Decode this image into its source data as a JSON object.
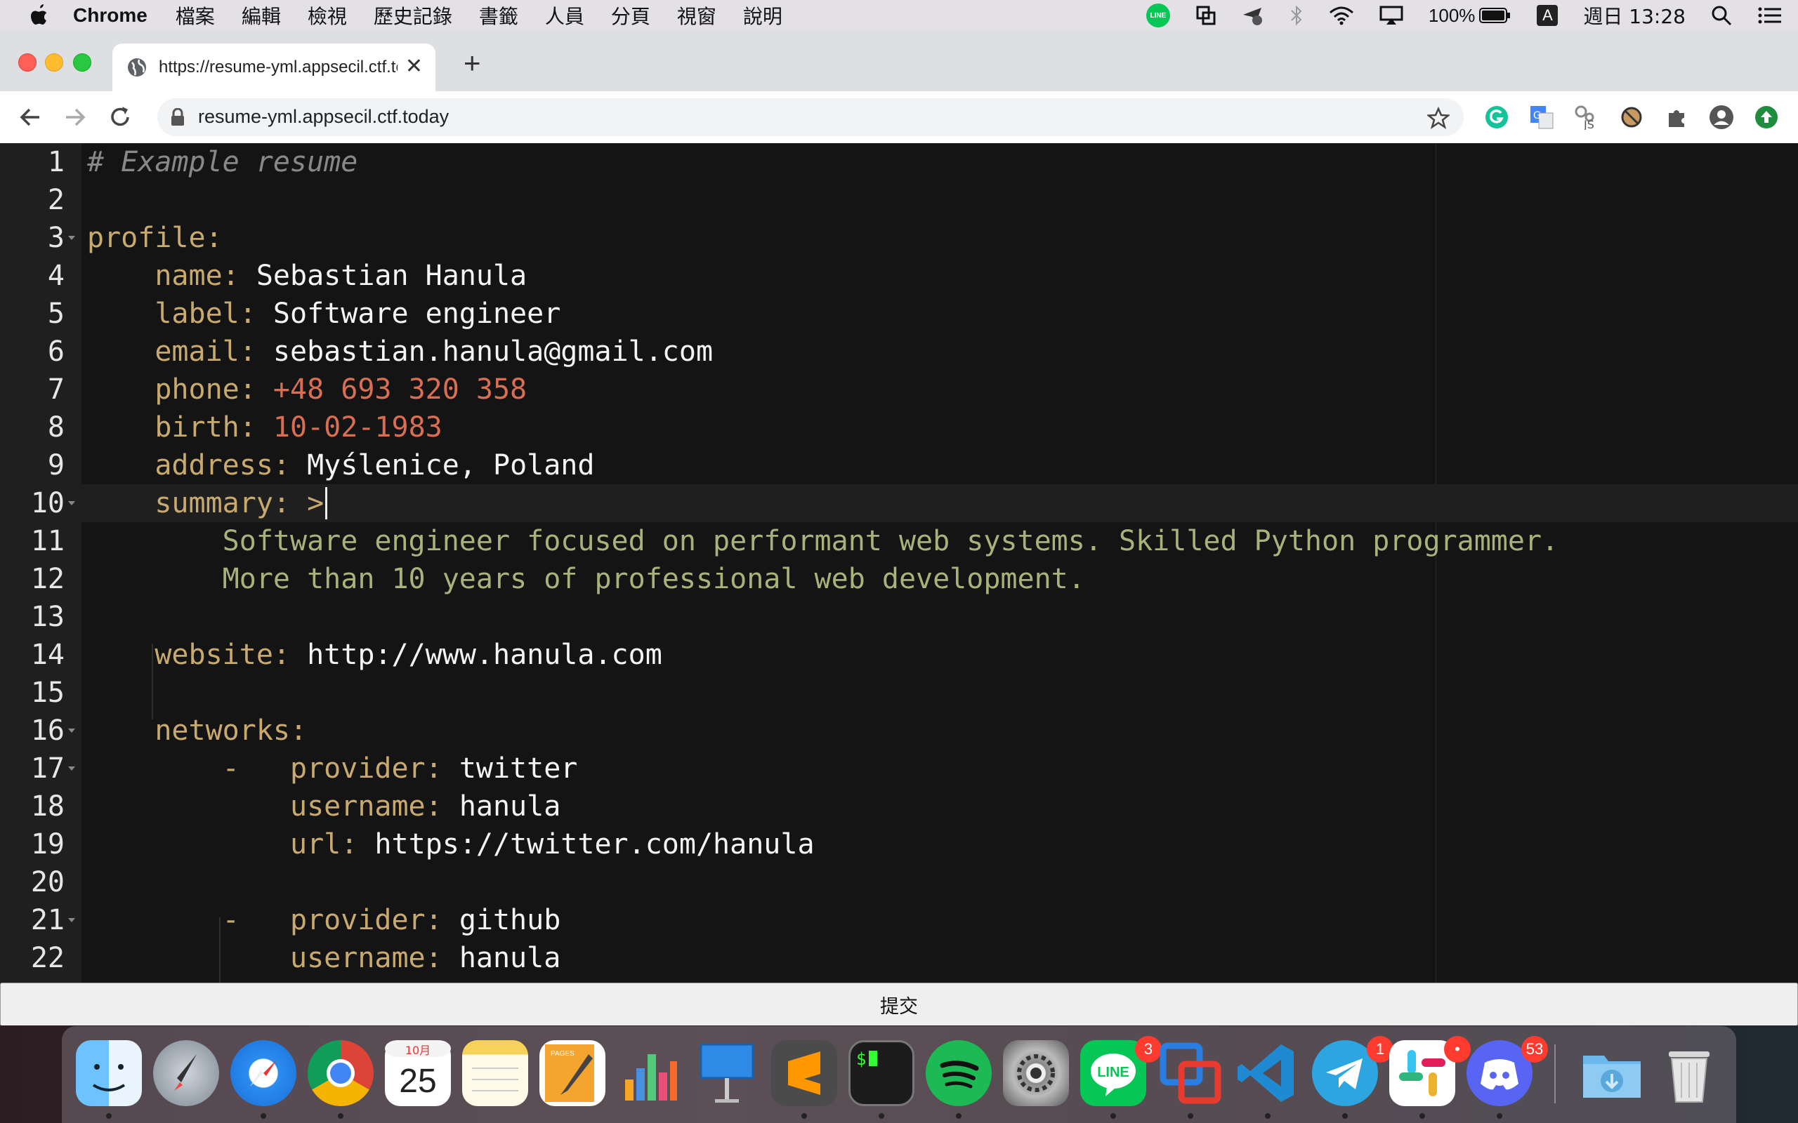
{
  "menubar": {
    "app_name": "Chrome",
    "items": [
      "檔案",
      "編輯",
      "檢視",
      "歷史記錄",
      "書籤",
      "人員",
      "分頁",
      "視窗",
      "說明"
    ],
    "line_label": "LINE",
    "battery": "100%",
    "input_method": "A",
    "clock": "週日 13:28"
  },
  "browser": {
    "tab_title": "https://resume-yml.appsecil.ctf.today",
    "url": "resume-yml.appsecil.ctf.today"
  },
  "editor": {
    "lines": [
      {
        "n": "1",
        "tokens": [
          {
            "t": "# Example resume",
            "c": "cmt"
          }
        ]
      },
      {
        "n": "2",
        "tokens": []
      },
      {
        "n": "3",
        "fold": true,
        "tokens": [
          {
            "t": "profile:",
            "c": "k"
          }
        ]
      },
      {
        "n": "4",
        "tokens": [
          {
            "t": "    name: ",
            "c": "k"
          },
          {
            "t": "Sebastian Hanula",
            "c": "v"
          }
        ]
      },
      {
        "n": "5",
        "tokens": [
          {
            "t": "    label: ",
            "c": "k"
          },
          {
            "t": "Software engineer",
            "c": "v"
          }
        ]
      },
      {
        "n": "6",
        "tokens": [
          {
            "t": "    email: ",
            "c": "k"
          },
          {
            "t": "sebastian.hanula@gmail.com",
            "c": "v"
          }
        ]
      },
      {
        "n": "7",
        "tokens": [
          {
            "t": "    phone: ",
            "c": "k"
          },
          {
            "t": "+48 693 320 358",
            "c": "num"
          }
        ]
      },
      {
        "n": "8",
        "tokens": [
          {
            "t": "    birth: ",
            "c": "k"
          },
          {
            "t": "10-02-1983",
            "c": "num"
          }
        ]
      },
      {
        "n": "9",
        "tokens": [
          {
            "t": "    address: ",
            "c": "k"
          },
          {
            "t": "Myślenice, Poland",
            "c": "v"
          }
        ]
      },
      {
        "n": "10",
        "fold": true,
        "active": true,
        "tokens": [
          {
            "t": "    summary: >",
            "c": "k"
          }
        ]
      },
      {
        "n": "11",
        "tokens": [
          {
            "t": "        Software engineer focused on performant web systems. Skilled Python programmer.",
            "c": "str"
          }
        ]
      },
      {
        "n": "12",
        "tokens": [
          {
            "t": "        More than 10 years of professional web development.",
            "c": "str"
          }
        ]
      },
      {
        "n": "13",
        "tokens": []
      },
      {
        "n": "14",
        "tokens": [
          {
            "t": "    website: ",
            "c": "k"
          },
          {
            "t": "http://www.hanula.com",
            "c": "v"
          }
        ]
      },
      {
        "n": "15",
        "tokens": []
      },
      {
        "n": "16",
        "fold": true,
        "tokens": [
          {
            "t": "    networks:",
            "c": "k"
          }
        ]
      },
      {
        "n": "17",
        "fold": true,
        "tokens": [
          {
            "t": "        -   ",
            "c": "k"
          },
          {
            "t": "provider: ",
            "c": "k"
          },
          {
            "t": "twitter",
            "c": "v"
          }
        ]
      },
      {
        "n": "18",
        "tokens": [
          {
            "t": "            username: ",
            "c": "k"
          },
          {
            "t": "hanula",
            "c": "v"
          }
        ]
      },
      {
        "n": "19",
        "tokens": [
          {
            "t": "            url: ",
            "c": "k"
          },
          {
            "t": "https://twitter.com/hanula",
            "c": "v"
          }
        ]
      },
      {
        "n": "20",
        "tokens": []
      },
      {
        "n": "21",
        "fold": true,
        "tokens": [
          {
            "t": "        -   ",
            "c": "k"
          },
          {
            "t": "provider: ",
            "c": "k"
          },
          {
            "t": "github",
            "c": "v"
          }
        ]
      },
      {
        "n": "22",
        "tokens": [
          {
            "t": "            username: ",
            "c": "k"
          },
          {
            "t": "hanula",
            "c": "v"
          }
        ]
      }
    ]
  },
  "submit": {
    "label": "提交"
  },
  "dock": {
    "calendar_month": "10月",
    "calendar_day": "25",
    "pages_label": "PAGES",
    "badges": {
      "line": "3",
      "telegram": "1",
      "slack": "•",
      "discord": "53"
    }
  },
  "colors": {
    "editor_bg": "#141414",
    "key": "#c8a96e",
    "value": "#f4f4f4",
    "number": "#d96e52",
    "string": "#a8b27a",
    "comment": "#888888"
  }
}
